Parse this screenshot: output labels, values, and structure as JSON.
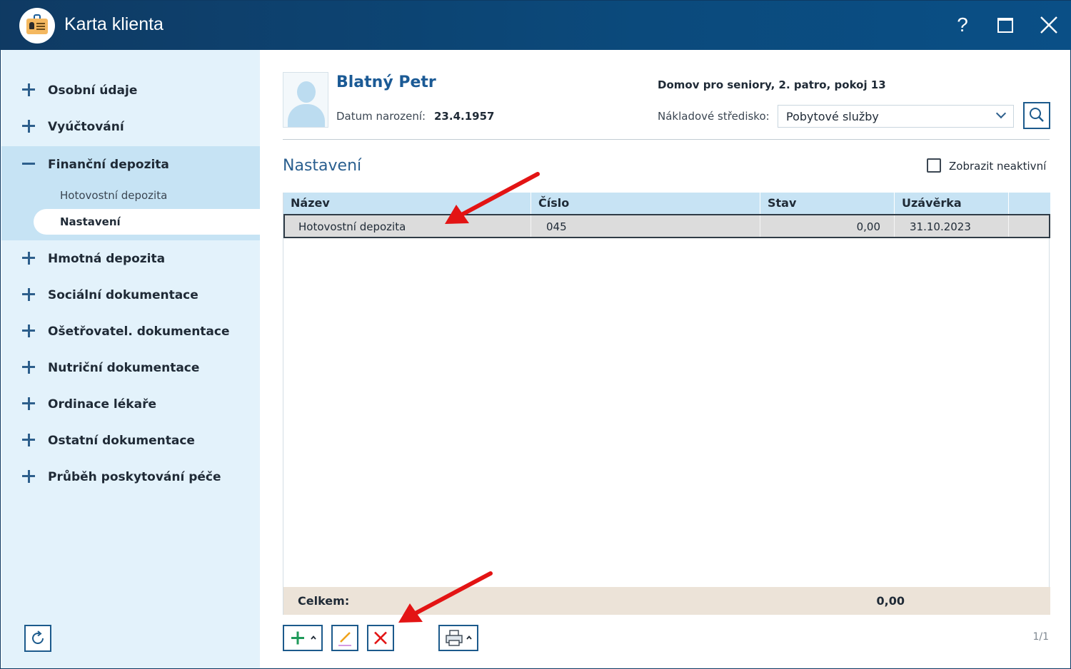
{
  "window": {
    "title": "Karta klienta",
    "help_label": "?"
  },
  "sidebar": {
    "items": [
      {
        "label": "Osobní údaje",
        "sign": "plus"
      },
      {
        "label": "Vyúčtování",
        "sign": "plus"
      },
      {
        "label": "Finanční depozita",
        "sign": "minus",
        "expanded": true,
        "children": [
          {
            "label": "Hotovostní depozita",
            "active": false
          },
          {
            "label": "Nastavení",
            "active": true
          }
        ]
      },
      {
        "label": "Hmotná depozita",
        "sign": "plus"
      },
      {
        "label": "Sociální dokumentace",
        "sign": "plus"
      },
      {
        "label": "Ošetřovatel. dokumentace",
        "sign": "plus"
      },
      {
        "label": "Nutriční dokumentace",
        "sign": "plus"
      },
      {
        "label": "Ordinace lékaře",
        "sign": "plus"
      },
      {
        "label": "Ostatní dokumentace",
        "sign": "plus"
      },
      {
        "label": "Průběh poskytování péče",
        "sign": "plus"
      }
    ]
  },
  "client": {
    "name": "Blatný Petr",
    "dob_label": "Datum narození:",
    "dob_value": "23.4.1957",
    "location": "Domov pro seniory, 2. patro, pokoj 13",
    "cost_center_label": "Nákladové středisko:",
    "cost_center_value": "Pobytové služby"
  },
  "section": {
    "title": "Nastavení",
    "show_inactive_label": "Zobrazit neaktivní",
    "show_inactive_checked": false
  },
  "table": {
    "columns": [
      "Název",
      "Číslo",
      "Stav",
      "Uzávěrka"
    ],
    "rows": [
      {
        "nazev": "Hotovostní depozita",
        "cislo": "045",
        "stav": "0,00",
        "uzaverka": "31.10.2023",
        "selected": true
      }
    ],
    "footer_label": "Celkem:",
    "footer_sum": "0,00"
  },
  "pager": {
    "text": "1/1"
  },
  "colors": {
    "titlebar": "#0f3a63",
    "sidebar": "#e3f2fb",
    "accent": "#1b5a95",
    "header": "#c7e3f4",
    "footer": "#ece3d8",
    "annotation": "#e31414"
  },
  "icons": {
    "app": "client-card-icon",
    "help": "question-icon",
    "maximize": "maximize-icon",
    "close": "close-icon",
    "search": "search-icon",
    "refresh": "refresh-icon",
    "add": "plus-icon",
    "edit": "pencil-icon",
    "delete": "x-icon",
    "print": "printer-icon"
  }
}
